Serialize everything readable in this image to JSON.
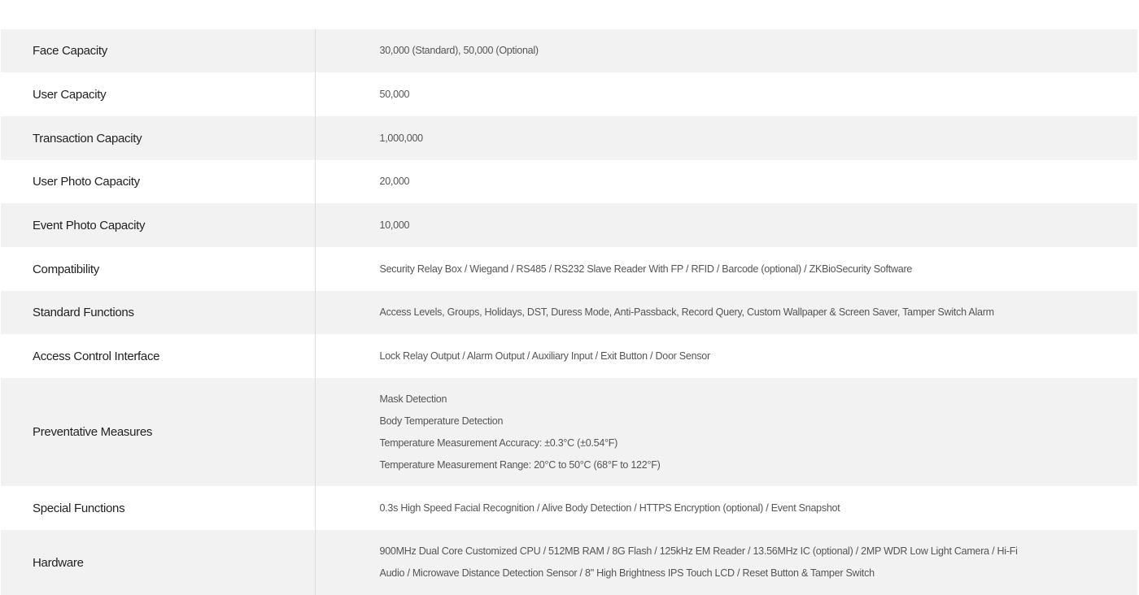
{
  "specs": [
    {
      "label": "Face Capacity",
      "lines": [
        "30,000 (Standard), 50,000 (Optional)"
      ]
    },
    {
      "label": "User Capacity",
      "lines": [
        "50,000"
      ]
    },
    {
      "label": "Transaction Capacity",
      "lines": [
        "1,000,000"
      ]
    },
    {
      "label": "User Photo Capacity",
      "lines": [
        "20,000"
      ]
    },
    {
      "label": "Event Photo Capacity",
      "lines": [
        "10,000"
      ]
    },
    {
      "label": "Compatibility",
      "lines": [
        "Security Relay Box / Wiegand / RS485 / RS232 Slave Reader With FP / RFID / Barcode (optional) / ZKBioSecurity Software"
      ]
    },
    {
      "label": "Standard Functions",
      "lines": [
        "Access Levels, Groups, Holidays, DST, Duress Mode, Anti-Passback, Record Query, Custom Wallpaper & Screen Saver, Tamper Switch Alarm"
      ]
    },
    {
      "label": "Access Control Interface",
      "lines": [
        "Lock Relay Output / Alarm Output / Auxiliary Input / Exit Button / Door Sensor"
      ]
    },
    {
      "label": "Preventative Measures",
      "lines": [
        "Mask Detection",
        "Body Temperature Detection",
        "Temperature Measurement Accuracy: ±0.3°C (±0.54°F)",
        "Temperature Measurement Range: 20°C to 50°C (68°F to 122°F)"
      ]
    },
    {
      "label": "Special Functions",
      "lines": [
        "0.3s High Speed Facial Recognition / Alive Body Detection / HTTPS Encryption (optional) / Event Snapshot"
      ]
    },
    {
      "label": "Hardware",
      "lines": [
        "900MHz Dual Core Customized CPU / 512MB RAM / 8G Flash / 125kHz EM Reader / 13.56MHz IC (optional) / 2MP WDR Low Light Camera / Hi-Fi",
        "Audio / Microwave Distance Detection Sensor / 8\" High Brightness IPS Touch LCD / Reset Button & Tamper Switch"
      ]
    }
  ]
}
